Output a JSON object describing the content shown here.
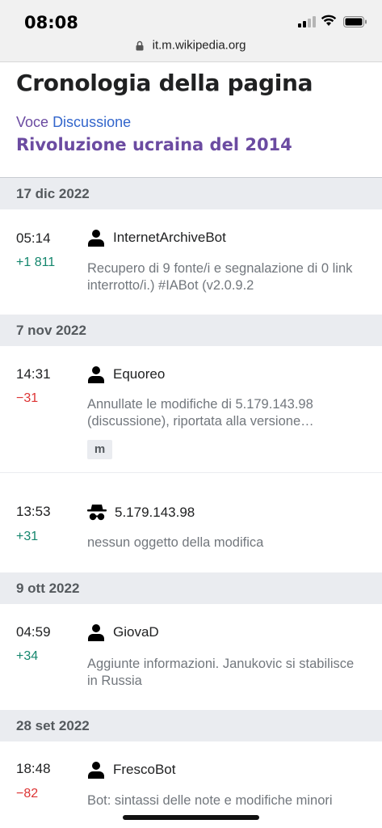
{
  "status_bar": {
    "time": "08:08",
    "url": "it.m.wikipedia.org"
  },
  "header": {
    "title": "Cronologia della pagina",
    "tab_voce": "Voce",
    "tab_discussione": "Discussione",
    "article_title": "Rivoluzione ucraina del 2014"
  },
  "groups": [
    {
      "date": "17 dic 2022",
      "entries": [
        {
          "time": "05:14",
          "diff": "+1 811",
          "user": "InternetArchiveBot",
          "summary": "Recupero di 9 fonte/i e segnalazione di 0 link interrotto/i.) #IABot (v2.0.9.2"
        }
      ]
    },
    {
      "date": "7 nov 2022",
      "entries": [
        {
          "time": "14:31",
          "diff": "−31",
          "user": "Equoreo",
          "summary": "Annullate le modifiche di 5.179.143.98 (discussione), riportata alla versione…",
          "minor": "m"
        },
        {
          "time": "13:53",
          "diff": "+31",
          "user": "5.179.143.98",
          "summary": "nessun oggetto della modifica"
        }
      ]
    },
    {
      "date": "9 ott 2022",
      "entries": [
        {
          "time": "04:59",
          "diff": "+34",
          "user": "GiovaD",
          "summary": "Aggiunte informazioni. Janukovic si stabilisce in Russia"
        }
      ]
    },
    {
      "date": "28 set 2022",
      "entries": [
        {
          "time": "18:48",
          "diff": "−82",
          "user": "FrescoBot",
          "summary": "Bot: sintassi delle note e modifiche minori"
        }
      ]
    }
  ],
  "colors": {
    "positive": "#14866d",
    "negative": "#dd3333",
    "visited_link": "#6b4ba1",
    "link": "#3366cc"
  },
  "icons": {
    "user": "user-icon",
    "anonymous": "anonymous-user-icon",
    "lock": "lock-icon"
  }
}
